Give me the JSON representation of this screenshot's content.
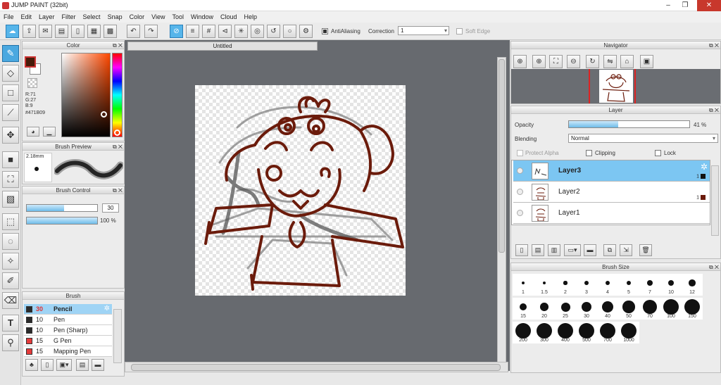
{
  "app": {
    "title": "JUMP PAINT (32bit)",
    "window_controls": {
      "minimize": "–",
      "maximize": "❐",
      "close": "✕"
    }
  },
  "menu": [
    "File",
    "Edit",
    "Layer",
    "Filter",
    "Select",
    "Snap",
    "Color",
    "View",
    "Tool",
    "Window",
    "Cloud",
    "Help"
  ],
  "toolbar": {
    "antialiasing_label": "AntiAliasing",
    "antialiasing_checked": true,
    "correction_label": "Correction",
    "correction_value": "1",
    "soft_edge_label": "Soft Edge",
    "soft_edge_checked": false
  },
  "color_panel": {
    "title": "Color",
    "foreground": "#471B09",
    "background": "#ffffff",
    "r_label": "R:71",
    "g_label": "G:27",
    "b_label": "B:9",
    "hex_label": "#471B09"
  },
  "brush_preview": {
    "title": "Brush Preview",
    "size": "2.18mm"
  },
  "brush_control": {
    "title": "Brush Control",
    "size_value": "30",
    "size_fraction": 0.53,
    "opacity_value": "100 %",
    "opacity_fraction": 1.0
  },
  "brush_panel": {
    "title": "Brush",
    "items": [
      {
        "size": "30",
        "name": "Pencil",
        "color": "#2a2a2a",
        "selected": true
      },
      {
        "size": "10",
        "name": "Pen",
        "color": "#2a2a2a",
        "selected": false
      },
      {
        "size": "10",
        "name": "Pen (Sharp)",
        "color": "#2a2a2a",
        "selected": false
      },
      {
        "size": "15",
        "name": "G Pen",
        "color": "#e53a3a",
        "selected": false
      },
      {
        "size": "15",
        "name": "Mapping Pen",
        "color": "#e53a3a",
        "selected": false
      }
    ]
  },
  "canvas": {
    "tab_label": "Untitled"
  },
  "navigator": {
    "title": "Navigator"
  },
  "layer_panel": {
    "title": "Layer",
    "opacity_label": "Opacity",
    "opacity_value": "41 %",
    "opacity_fraction": 0.41,
    "blending_label": "Blending",
    "blending_value": "Normal",
    "protect_alpha_label": "Protect Alpha",
    "clipping_label": "Clipping",
    "lock_label": "Lock",
    "layers": [
      {
        "name": "Layer3",
        "count": "1",
        "color": "#111111",
        "selected": true
      },
      {
        "name": "Layer2",
        "count": "1",
        "color": "#6b1b0b",
        "selected": false
      },
      {
        "name": "Layer1",
        "count": "",
        "color": "",
        "selected": false
      }
    ]
  },
  "brush_size": {
    "title": "Brush Size",
    "sizes": [
      "1",
      "1.5",
      "2",
      "3",
      "4",
      "5",
      "7",
      "10",
      "12",
      "15",
      "20",
      "25",
      "30",
      "40",
      "50",
      "70",
      "100",
      "150",
      "200",
      "300",
      "400",
      "500",
      "700",
      "1000"
    ]
  }
}
